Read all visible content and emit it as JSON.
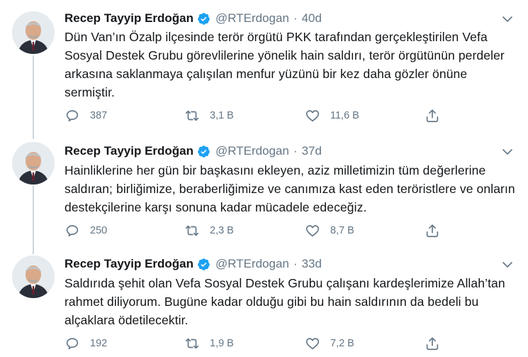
{
  "tweets": [
    {
      "name": "Recep Tayyip Erdoğan",
      "handle": "@RTErdogan",
      "separator": "·",
      "time": "40d",
      "text": "Dün Van’ın Özalp ilçesinde terör örgütü PKK tarafından gerçekleştirilen Vefa Sosyal Destek Grubu görevlilerine yönelik hain saldırı, terör örgütünün perdeler arkasına saklanmaya çalışılan menfur yüzünü bir kez daha gözler önüne sermiştir.",
      "replies": "387",
      "retweets": "3,1 B",
      "likes": "11,6 B"
    },
    {
      "name": "Recep Tayyip Erdoğan",
      "handle": "@RTErdogan",
      "separator": "·",
      "time": "37d",
      "text": "Hainliklerine her gün bir başkasını ekleyen, aziz milletimizin tüm değerlerine saldıran; birliğimize, beraberliğimize ve canımıza kast eden teröristlere ve onların destekçilerine karşı sonuna kadar mücadele edeceğiz.",
      "replies": "250",
      "retweets": "2,3 B",
      "likes": "8,7 B"
    },
    {
      "name": "Recep Tayyip Erdoğan",
      "handle": "@RTErdogan",
      "separator": "·",
      "time": "33d",
      "text": "Saldırıda şehit olan Vefa Sosyal Destek Grubu çalışanı kardeşlerimize Allah’tan rahmet diliyorum. Bugüne kadar olduğu gibi bu hain saldırının da bedeli bu alçaklara ödetilecektir.",
      "replies": "192",
      "retweets": "1,9 B",
      "likes": "7,2 B"
    }
  ],
  "icons": {
    "verified": "verified-badge-icon",
    "menu": "chevron-down-icon",
    "reply": "reply-icon",
    "retweet": "retweet-icon",
    "like": "heart-icon",
    "share": "share-icon"
  },
  "colors": {
    "verified": "#1da1f2",
    "text": "#14171a",
    "secondary": "#657786",
    "thread": "#ccd6dd"
  }
}
